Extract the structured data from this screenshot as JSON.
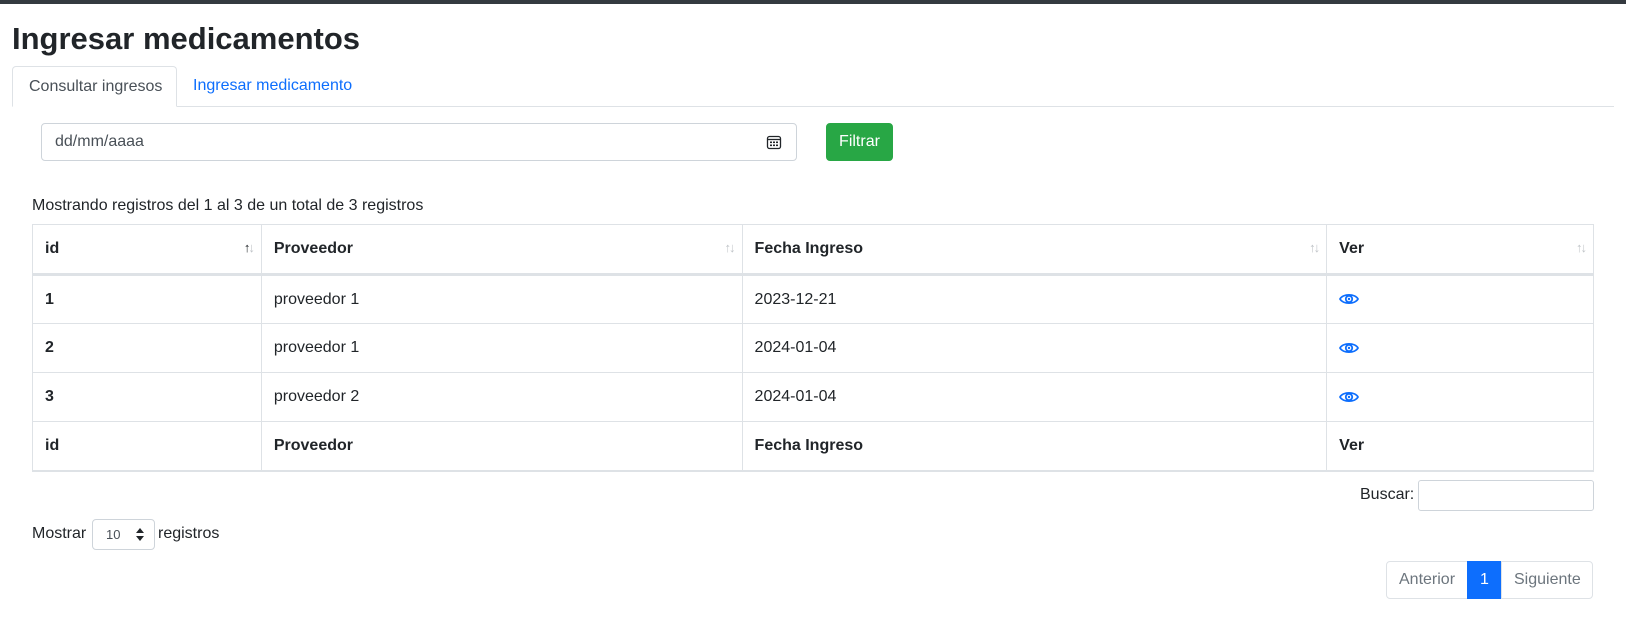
{
  "page": {
    "title": "Ingresar medicamentos"
  },
  "tabs": [
    {
      "label": "Consultar ingresos",
      "active": true
    },
    {
      "label": "Ingresar medicamento",
      "active": false
    }
  ],
  "filter": {
    "date_placeholder": "dd/mm/aaaa",
    "button_label": "Filtrar",
    "calendar_icon": "calendar-icon"
  },
  "table_info": "Mostrando registros del 1 al 3 de un total de 3 registros",
  "table": {
    "columns": [
      "id",
      "Proveedor",
      "Fecha Ingreso",
      "Ver"
    ],
    "rows": [
      {
        "id": "1",
        "proveedor": "proveedor 1",
        "fecha": "2023-12-21",
        "action_icon": "eye-icon"
      },
      {
        "id": "2",
        "proveedor": "proveedor 1",
        "fecha": "2024-01-04",
        "action_icon": "eye-icon"
      },
      {
        "id": "3",
        "proveedor": "proveedor 2",
        "fecha": "2024-01-04",
        "action_icon": "eye-icon"
      }
    ],
    "footer": [
      "id",
      "Proveedor",
      "Fecha Ingreso",
      "Ver"
    ],
    "sorted_column": "id"
  },
  "search": {
    "label": "Buscar:",
    "value": ""
  },
  "length": {
    "prefix": "Mostrar",
    "value": "10",
    "suffix": "registros"
  },
  "pagination": {
    "prev": "Anterior",
    "current": "1",
    "next": "Siguiente"
  },
  "colors": {
    "accent": "#0d6efd",
    "success": "#28a745",
    "top_bar": "#343a40"
  }
}
